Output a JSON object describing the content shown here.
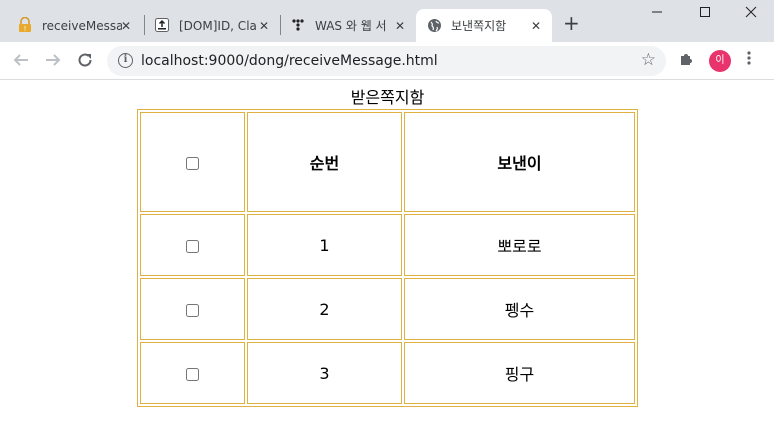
{
  "browser": {
    "tabs": [
      {
        "title": "receiveMessa",
        "icon": "lock-warning-icon",
        "active": false
      },
      {
        "title": "[DOM]ID, Cla",
        "icon": "upload-icon",
        "active": false
      },
      {
        "title": "WAS 와 웹 서",
        "icon": "dots-icon",
        "active": false
      },
      {
        "title": "보낸쪽지함",
        "icon": "globe-icon",
        "active": true
      }
    ],
    "url": "localhost:9000/dong/receiveMessage.html",
    "profile_initial": "이"
  },
  "page": {
    "caption": "받은쪽지함",
    "headers": {
      "number": "순번",
      "sender": "보낸이"
    },
    "rows": [
      {
        "number": "1",
        "sender": "뽀로로"
      },
      {
        "number": "2",
        "sender": "펭수"
      },
      {
        "number": "3",
        "sender": "핑구"
      }
    ]
  },
  "colors": {
    "table_border": "#e0b040",
    "tab_strip": "#dee1e6",
    "avatar": "#e8336d"
  }
}
